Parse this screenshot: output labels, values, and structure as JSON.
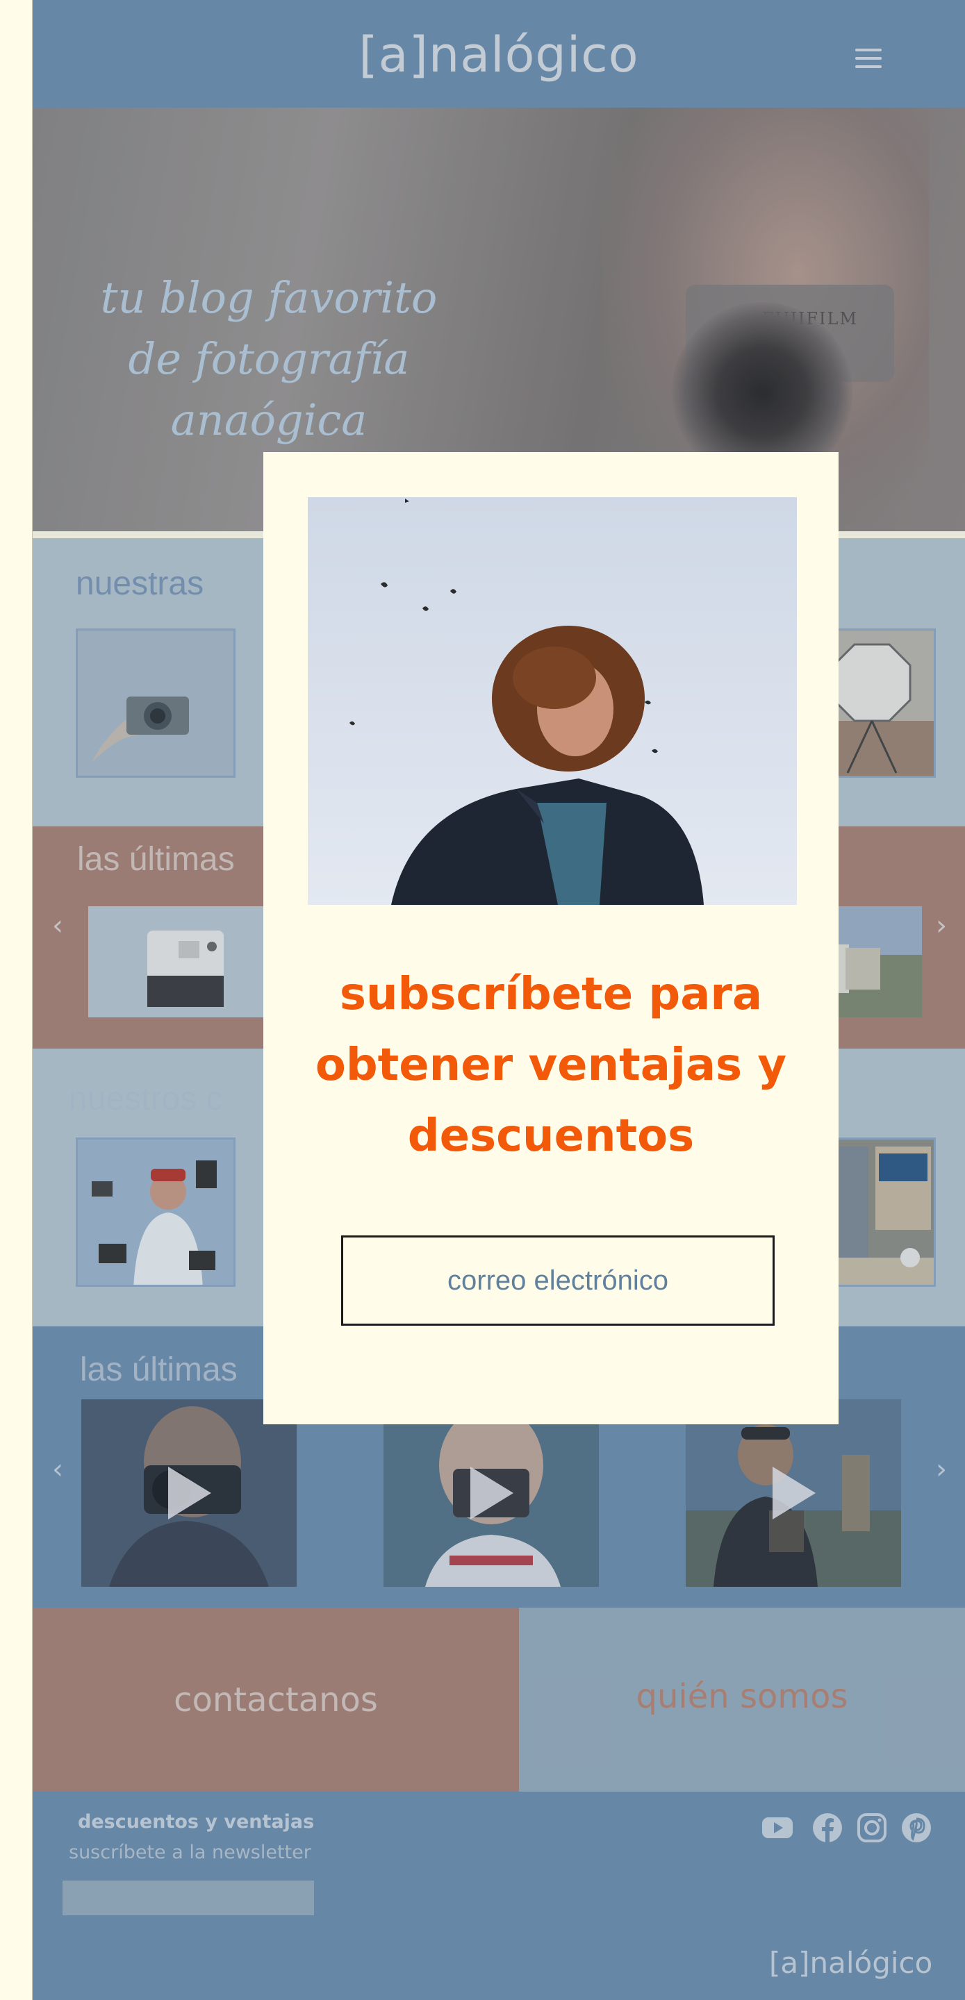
{
  "header": {
    "logo": "[a]nalógico",
    "menu_icon": "hamburger-icon"
  },
  "hero": {
    "title": "tu blog favorito de fotografía anaógica",
    "camera_brand": "FUJIFILM"
  },
  "sections": {
    "categories_title": "nuestras",
    "latest_posts_title": "las últimas",
    "ours_title": "nuestros c",
    "latest_videos_title": "las últimas"
  },
  "contact": {
    "label": "contactanos"
  },
  "about": {
    "label": "quién somos"
  },
  "footer": {
    "newsletter_title": "descuentos y ventajas",
    "newsletter_sub": "suscríbete a la newsletter",
    "logo": "[a]nalógico",
    "social_icons": [
      "youtube-icon",
      "facebook-icon",
      "instagram-icon",
      "pinterest-icon"
    ]
  },
  "modal": {
    "title": "subscríbete para obtener ventajas y descuentos",
    "email_placeholder": "correo electrónico"
  },
  "colors": {
    "accent_orange": "#f25a0a",
    "header_blue": "#6d8faf",
    "cream": "#fffde9",
    "terracotta": "#a98276",
    "light_blue": "#b5c5d1"
  }
}
